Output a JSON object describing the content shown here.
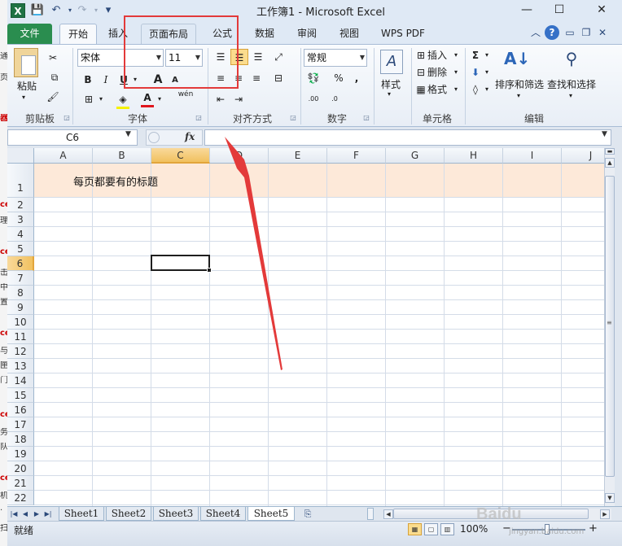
{
  "window": {
    "title": "工作簿1 - Microsoft Excel",
    "app_icon": "X",
    "controls": {
      "minimize": "—",
      "maximize": "☐",
      "close": "✕"
    }
  },
  "quick_access": {
    "save": "💾",
    "undo": "↶",
    "redo": "↷",
    "customize": "▾"
  },
  "ribbon_tabs": {
    "file": "文件",
    "items": [
      "开始",
      "插入",
      "页面布局",
      "公式",
      "数据",
      "审阅",
      "视图",
      "WPS PDF"
    ],
    "active": "开始"
  },
  "ribbon": {
    "clipboard": {
      "paste": "粘贴",
      "label": "剪贴板"
    },
    "font": {
      "name": "宋体",
      "size": "11",
      "bold": "B",
      "italic": "I",
      "underline": "U",
      "grow": "A",
      "shrink": "A",
      "font_color_glyph": "A",
      "wen": "wén",
      "label": "字体"
    },
    "alignment": {
      "label": "对齐方式"
    },
    "number": {
      "format": "常规",
      "percent": "%",
      "comma": ",",
      "label": "数字"
    },
    "styles": {
      "label": "样式"
    },
    "cells": {
      "insert": "插入",
      "delete": "删除",
      "format": "格式",
      "label": "单元格"
    },
    "editing": {
      "sigma": "Σ",
      "sort_filter": "排序和筛选",
      "find_select": "查找和选择",
      "label": "编辑"
    }
  },
  "formula_bar": {
    "name_box": "C6",
    "fx": "fx",
    "content": ""
  },
  "grid": {
    "columns": [
      "A",
      "B",
      "C",
      "D",
      "E",
      "F",
      "G",
      "H",
      "I",
      "J"
    ],
    "selected_column": "C",
    "rows": [
      "1",
      "2",
      "3",
      "4",
      "5",
      "6",
      "7",
      "8",
      "9",
      "10",
      "11",
      "12",
      "13",
      "14",
      "15",
      "16",
      "17",
      "18",
      "19",
      "20",
      "21",
      "22"
    ],
    "selected_row": "6",
    "active_cell": "C6",
    "title_cell_text": "每页都要有的标题",
    "title_fill": "#fde9d9"
  },
  "sheets": {
    "items": [
      "Sheet1",
      "Sheet2",
      "Sheet3",
      "Sheet4",
      "Sheet5"
    ],
    "active": "Sheet5"
  },
  "status_bar": {
    "status": "就绪",
    "zoom": "100%",
    "zoom_minus": "−",
    "zoom_plus": "+"
  },
  "annotation": {
    "color": "#e33a3a",
    "highlighted_tab": "页面布局"
  },
  "watermark": {
    "text": "Baidu",
    "sub": "jingyan.baidu.com"
  },
  "left_strip_chars": [
    "通",
    "页",
    "器",
    "ce",
    "理",
    "ce",
    "击",
    "中",
    "置",
    "ce",
    "与",
    "匣",
    "门",
    "ce",
    "务",
    "队",
    "ce",
    "机",
    "·",
    "扫"
  ]
}
